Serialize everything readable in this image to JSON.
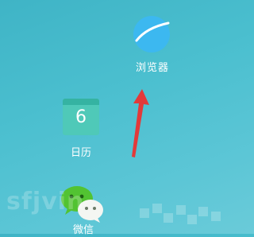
{
  "apps": {
    "browser": {
      "label": "浏览器",
      "icon": "planet-icon",
      "color": "#3cb8f0"
    },
    "calendar": {
      "label": "日历",
      "day": "6",
      "icon": "calendar-icon",
      "color": "#4fc9b8"
    },
    "wechat": {
      "label": "微信",
      "icon": "wechat-icon",
      "color": "#52c332"
    }
  },
  "annotation": {
    "arrow_color": "#e23a3a"
  },
  "watermark": {
    "text": "sfjvin"
  }
}
